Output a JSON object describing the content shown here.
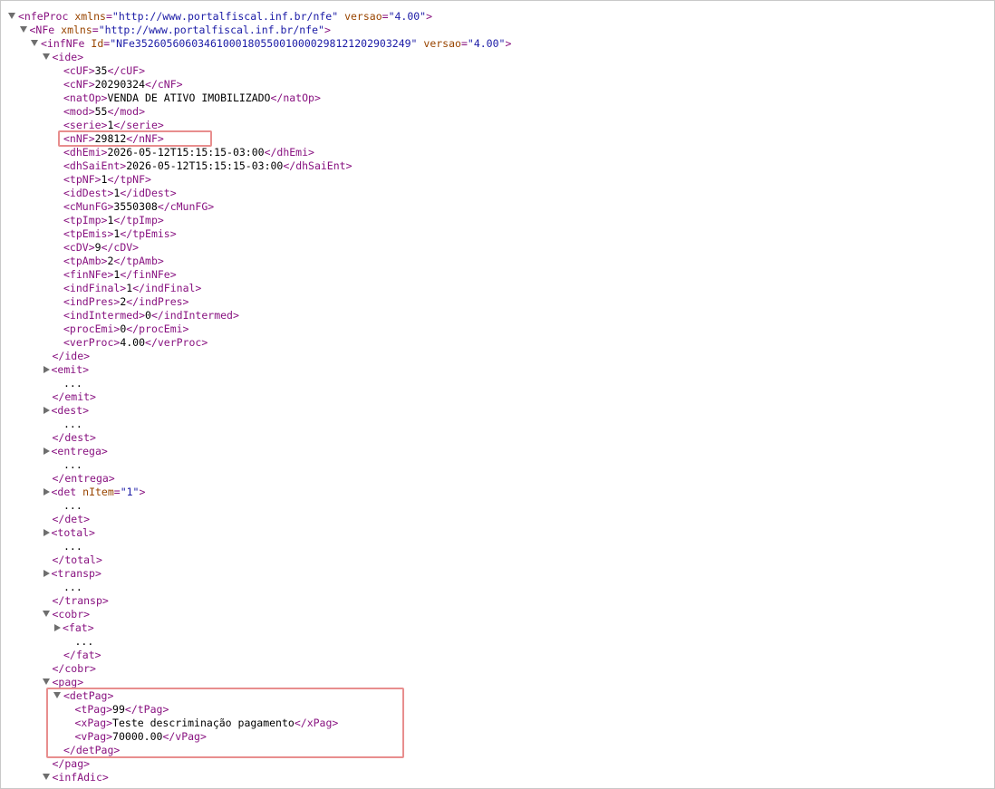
{
  "lines": [
    {
      "indent": 0,
      "type": "open",
      "toggle": "down",
      "tag": "nfeProc",
      "attrs": [
        {
          "name": "xmlns",
          "value": "\"http://www.portalfiscal.inf.br/nfe\""
        },
        {
          "name": "versao",
          "value": "\"4.00\""
        }
      ]
    },
    {
      "indent": 1,
      "type": "open",
      "toggle": "down",
      "tag": "NFe",
      "attrs": [
        {
          "name": "xmlns",
          "value": "\"http://www.portalfiscal.inf.br/nfe\""
        }
      ]
    },
    {
      "indent": 2,
      "type": "open",
      "toggle": "down",
      "tag": "infNFe",
      "attrs": [
        {
          "name": "Id",
          "value": "\"NFe35260560603461000180550010000298121202903249\""
        },
        {
          "name": "versao",
          "value": "\"4.00\""
        }
      ]
    },
    {
      "indent": 3,
      "type": "open",
      "toggle": "down",
      "tag": "ide",
      "attrs": []
    },
    {
      "indent": 4,
      "type": "leaf",
      "tag": "cUF",
      "text": "35"
    },
    {
      "indent": 4,
      "type": "leaf",
      "tag": "cNF",
      "text": "20290324"
    },
    {
      "indent": 4,
      "type": "leaf",
      "tag": "natOp",
      "text": "VENDA DE ATIVO IMOBILIZADO"
    },
    {
      "indent": 4,
      "type": "leaf",
      "tag": "mod",
      "text": "55"
    },
    {
      "indent": 4,
      "type": "leaf",
      "tag": "serie",
      "text": "1"
    },
    {
      "indent": 4,
      "type": "leaf",
      "tag": "nNF",
      "text": "29812"
    },
    {
      "indent": 4,
      "type": "leaf",
      "tag": "dhEmi",
      "text": "2026-05-12T15:15:15-03:00"
    },
    {
      "indent": 4,
      "type": "leaf",
      "tag": "dhSaiEnt",
      "text": "2026-05-12T15:15:15-03:00"
    },
    {
      "indent": 4,
      "type": "leaf",
      "tag": "tpNF",
      "text": "1"
    },
    {
      "indent": 4,
      "type": "leaf",
      "tag": "idDest",
      "text": "1"
    },
    {
      "indent": 4,
      "type": "leaf",
      "tag": "cMunFG",
      "text": "3550308"
    },
    {
      "indent": 4,
      "type": "leaf",
      "tag": "tpImp",
      "text": "1"
    },
    {
      "indent": 4,
      "type": "leaf",
      "tag": "tpEmis",
      "text": "1"
    },
    {
      "indent": 4,
      "type": "leaf",
      "tag": "cDV",
      "text": "9"
    },
    {
      "indent": 4,
      "type": "leaf",
      "tag": "tpAmb",
      "text": "2"
    },
    {
      "indent": 4,
      "type": "leaf",
      "tag": "finNFe",
      "text": "1"
    },
    {
      "indent": 4,
      "type": "leaf",
      "tag": "indFinal",
      "text": "1"
    },
    {
      "indent": 4,
      "type": "leaf",
      "tag": "indPres",
      "text": "2"
    },
    {
      "indent": 4,
      "type": "leaf",
      "tag": "indIntermed",
      "text": "0"
    },
    {
      "indent": 4,
      "type": "leaf",
      "tag": "procEmi",
      "text": "0"
    },
    {
      "indent": 4,
      "type": "leaf",
      "tag": "verProc",
      "text": "4.00"
    },
    {
      "indent": 3,
      "type": "close",
      "tag": "ide"
    },
    {
      "indent": 3,
      "type": "open",
      "toggle": "right",
      "tag": "emit",
      "attrs": []
    },
    {
      "indent": 4,
      "type": "ellipsis",
      "text": "..."
    },
    {
      "indent": 3,
      "type": "close",
      "tag": "emit"
    },
    {
      "indent": 3,
      "type": "open",
      "toggle": "right",
      "tag": "dest",
      "attrs": []
    },
    {
      "indent": 4,
      "type": "ellipsis",
      "text": "..."
    },
    {
      "indent": 3,
      "type": "close",
      "tag": "dest"
    },
    {
      "indent": 3,
      "type": "open",
      "toggle": "right",
      "tag": "entrega",
      "attrs": []
    },
    {
      "indent": 4,
      "type": "ellipsis",
      "text": "..."
    },
    {
      "indent": 3,
      "type": "close",
      "tag": "entrega"
    },
    {
      "indent": 3,
      "type": "open",
      "toggle": "right",
      "tag": "det",
      "attrs": [
        {
          "name": "nItem",
          "value": "\"1\""
        }
      ]
    },
    {
      "indent": 4,
      "type": "ellipsis",
      "text": "..."
    },
    {
      "indent": 3,
      "type": "close",
      "tag": "det"
    },
    {
      "indent": 3,
      "type": "open",
      "toggle": "right",
      "tag": "total",
      "attrs": []
    },
    {
      "indent": 4,
      "type": "ellipsis",
      "text": "..."
    },
    {
      "indent": 3,
      "type": "close",
      "tag": "total"
    },
    {
      "indent": 3,
      "type": "open",
      "toggle": "right",
      "tag": "transp",
      "attrs": []
    },
    {
      "indent": 4,
      "type": "ellipsis",
      "text": "..."
    },
    {
      "indent": 3,
      "type": "close",
      "tag": "transp"
    },
    {
      "indent": 3,
      "type": "open",
      "toggle": "down",
      "tag": "cobr",
      "attrs": []
    },
    {
      "indent": 4,
      "type": "open",
      "toggle": "right",
      "tag": "fat",
      "attrs": []
    },
    {
      "indent": 5,
      "type": "ellipsis",
      "text": "..."
    },
    {
      "indent": 4,
      "type": "close",
      "tag": "fat"
    },
    {
      "indent": 3,
      "type": "close",
      "tag": "cobr"
    },
    {
      "indent": 3,
      "type": "open",
      "toggle": "down",
      "tag": "pag",
      "attrs": []
    },
    {
      "indent": 4,
      "type": "open",
      "toggle": "down",
      "tag": "detPag",
      "attrs": []
    },
    {
      "indent": 5,
      "type": "leaf",
      "tag": "tPag",
      "text": "99"
    },
    {
      "indent": 5,
      "type": "leaf",
      "tag": "xPag",
      "text": "Teste descriminação pagamento"
    },
    {
      "indent": 5,
      "type": "leaf",
      "tag": "vPag",
      "text": "70000.00"
    },
    {
      "indent": 4,
      "type": "close",
      "tag": "detPag"
    },
    {
      "indent": 3,
      "type": "close",
      "tag": "pag"
    },
    {
      "indent": 3,
      "type": "open",
      "toggle": "down",
      "tag": "infAdic",
      "attrs": []
    }
  ]
}
